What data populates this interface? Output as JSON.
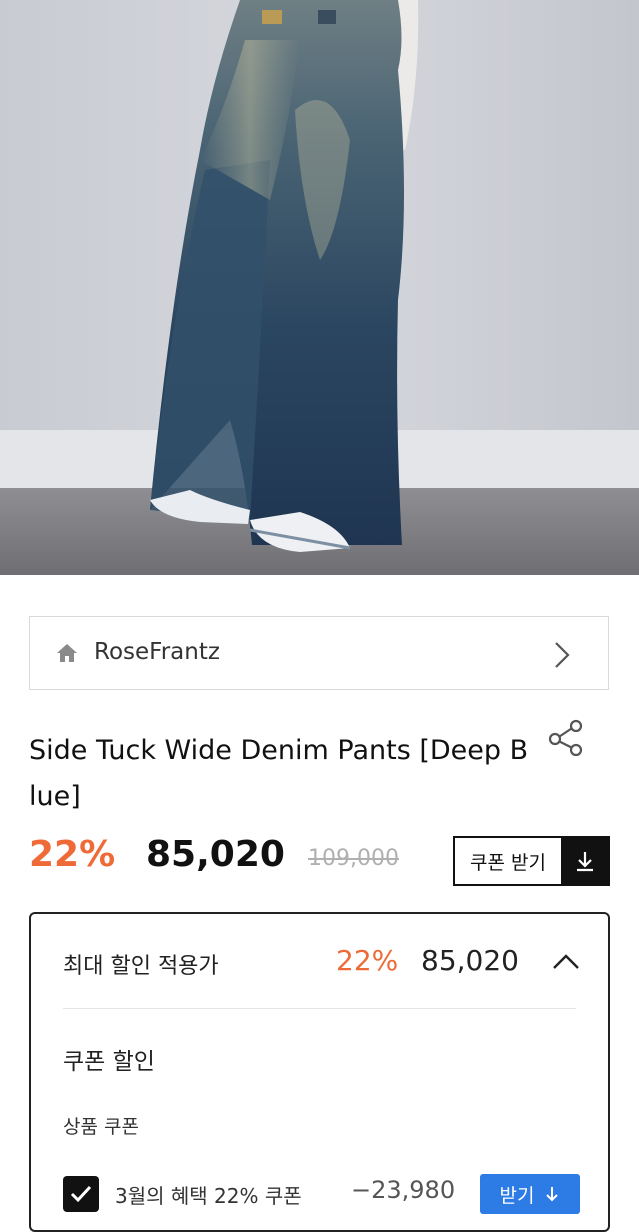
{
  "product_image": {
    "alt": "denim-wide-pants-photo"
  },
  "brand": {
    "name": "RoseFrantz",
    "icon": "home-icon"
  },
  "product": {
    "title": "Side Tuck Wide Denim Pants [Deep Blue]",
    "discount_rate": "22%",
    "price": "85,020",
    "original_price": "109,000"
  },
  "coupon_button": {
    "label": "쿠폰 받기",
    "icon": "download-icon"
  },
  "discount_panel": {
    "title": "최대 할인 적용가",
    "rate": "22%",
    "price": "85,020",
    "section_title": "쿠폰 할인",
    "sub_title": "상품 쿠폰",
    "coupon": {
      "name": "3월의 혜택 22% 쿠폰",
      "amount": "−23,980",
      "button_label": "받기",
      "checked": true
    }
  },
  "colors": {
    "accent": "#ee6a37",
    "primary_button": "#2d7be5",
    "dark": "#111111"
  }
}
